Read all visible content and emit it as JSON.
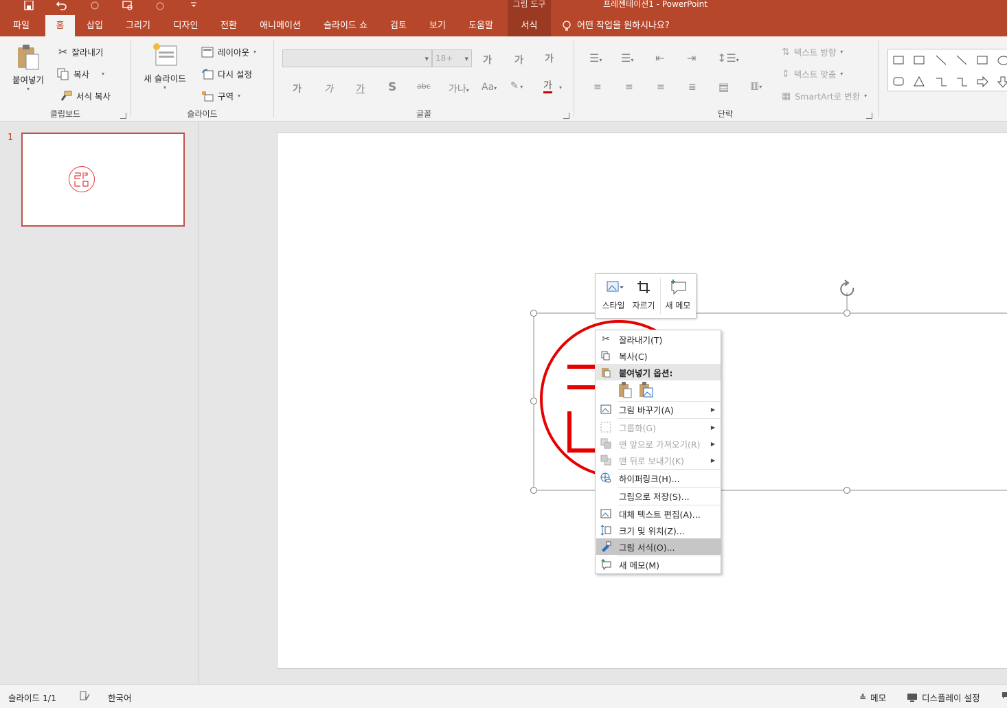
{
  "window": {
    "context_tab_group": "그림 도구",
    "title": "프레젠테이션1 - PowerPoint"
  },
  "qat": [
    {
      "icon": "save-icon"
    },
    {
      "icon": "undo-icon"
    },
    {
      "icon": "redo-icon"
    },
    {
      "icon": "present-from-start-icon"
    },
    {
      "icon": "touch-mode-icon"
    },
    {
      "icon": "customize-qat-icon"
    }
  ],
  "tabs": [
    "파일",
    "홈",
    "삽입",
    "그리기",
    "디자인",
    "전환",
    "애니메이션",
    "슬라이드 쇼",
    "검토",
    "보기",
    "도움말",
    "서식"
  ],
  "active_tab": "홈",
  "tell_me": "어떤 작업을 원하시나요?",
  "ribbon": {
    "clipboard": {
      "label": "클립보드",
      "paste": "붙여넣기",
      "cut": "잘라내기",
      "copy": "복사",
      "format_painter": "서식 복사"
    },
    "slides": {
      "label": "슬라이드",
      "new_slide": "새 슬라이드",
      "layout": "레이아웃",
      "reset": "다시 설정",
      "section": "구역"
    },
    "font": {
      "label": "글꼴",
      "font_size": "18+"
    },
    "paragraph": {
      "label": "단락",
      "text_direction": "텍스트 방향",
      "align_text": "텍스트 맞춤",
      "smartart": "SmartArt로 변환"
    }
  },
  "thumbnails": [
    {
      "number": "1"
    }
  ],
  "mini_toolbar": {
    "style": "스타일",
    "crop": "자르기",
    "new_comment": "새 메모"
  },
  "context_menu": {
    "cut": "잘라내기(T)",
    "copy": "복사(C)",
    "paste_options": "붙여넣기 옵션:",
    "change_picture": "그림 바꾸기(A)",
    "group": "그룹화(G)",
    "bring_to_front": "맨 앞으로 가져오기(R)",
    "send_to_back": "맨 뒤로 보내기(K)",
    "hyperlink": "하이퍼링크(H)...",
    "save_as_picture": "그림으로 저장(S)...",
    "edit_alt_text": "대체 텍스트 편집(A)...",
    "size_position": "크기 및 위치(Z)...",
    "format_picture": "그림 서식(O)...",
    "new_comment": "새 메모(M)"
  },
  "statusbar": {
    "slide_count": "슬라이드 1/1",
    "language": "한국어",
    "notes": "메모",
    "display_settings": "디스플레이 설정"
  },
  "colors": {
    "accent": "#b7472a",
    "seal_red": "#e60000"
  }
}
